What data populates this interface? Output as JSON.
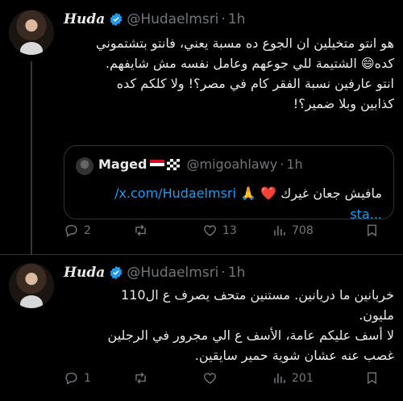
{
  "tweets": [
    {
      "author": "Huda",
      "handle": "@Hudaelmsri",
      "time": "1h",
      "lines": [
        "هو انتو متخيلين ان الجوع ده مسبة يعني، فانتو بتشتموني",
        "كده😄 الشتيمة للي جوعهم وعامل نفسه مش شايفهم.",
        "انتو عارفين نسبة الفقر كام في مصر؟! ولا كلكم كده",
        "كذابين وبلا ضمير؟!"
      ],
      "quote": {
        "author": "Maged",
        "handle": "@migoahlawy",
        "time": "1h",
        "text": "مافيش جعان غيرك",
        "emoji": "❤️ 🙏",
        "link": "x.com/Hudaelmsri/",
        "link_tail": "...sta"
      },
      "stats": {
        "replies": "2",
        "retweets": "",
        "likes": "13",
        "views": "708"
      }
    },
    {
      "author": "Huda",
      "handle": "@Hudaelmsri",
      "time": "1h",
      "lines": [
        "خربانين ما دريانين. مستنين متحف يصرف ع ال110",
        "مليون.",
        "لا أسف عليكم عامة، الأسف ع الي مجرور في الرجلين",
        "غصب عنه عشان شوية حمير سايقين."
      ],
      "stats": {
        "replies": "1",
        "retweets": "",
        "likes": "",
        "views": "201"
      }
    }
  ],
  "colors": {
    "accent": "#1d9bf0",
    "muted": "#71767b",
    "verified": "#1d9bf0"
  },
  "icons": [
    "reply-icon",
    "retweet-icon",
    "like-icon",
    "views-icon",
    "bookmark-icon",
    "verified-icon"
  ]
}
